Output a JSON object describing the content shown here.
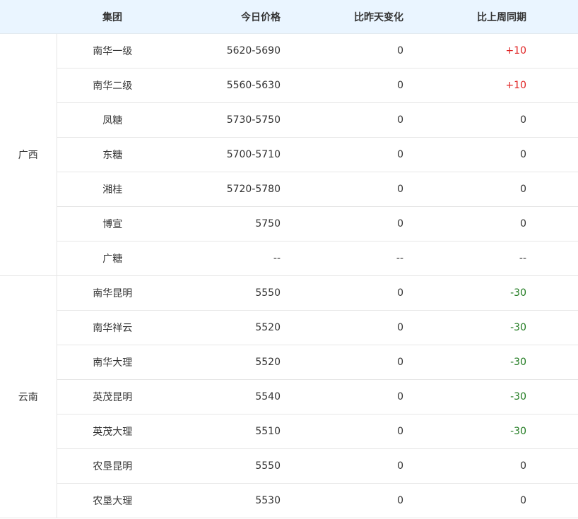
{
  "header": {
    "group": "集团",
    "price": "今日价格",
    "dod": "比昨天变化",
    "wow": "比上周同期"
  },
  "colors": {
    "up": "#e02424",
    "down": "#1f7a1f",
    "header_bg": "#eaf5ff"
  },
  "regions": [
    {
      "name": "广西",
      "rows": [
        {
          "group": "南华一级",
          "price": "5620-5690",
          "dod": "0",
          "wow": "+10",
          "trend": "up"
        },
        {
          "group": "南华二级",
          "price": "5560-5630",
          "dod": "0",
          "wow": "+10",
          "trend": "up"
        },
        {
          "group": "凤糖",
          "price": "5730-5750",
          "dod": "0",
          "wow": "0",
          "trend": "flat"
        },
        {
          "group": "东糖",
          "price": "5700-5710",
          "dod": "0",
          "wow": "0",
          "trend": "flat"
        },
        {
          "group": "湘桂",
          "price": "5720-5780",
          "dod": "0",
          "wow": "0",
          "trend": "flat"
        },
        {
          "group": "博宣",
          "price": "5750",
          "dod": "0",
          "wow": "0",
          "trend": "flat"
        },
        {
          "group": "广糖",
          "price": "--",
          "dod": "--",
          "wow": "--",
          "trend": "flat"
        }
      ]
    },
    {
      "name": "云南",
      "rows": [
        {
          "group": "南华昆明",
          "price": "5550",
          "dod": "0",
          "wow": "-30",
          "trend": "down"
        },
        {
          "group": "南华祥云",
          "price": "5520",
          "dod": "0",
          "wow": "-30",
          "trend": "down"
        },
        {
          "group": "南华大理",
          "price": "5520",
          "dod": "0",
          "wow": "-30",
          "trend": "down"
        },
        {
          "group": "英茂昆明",
          "price": "5540",
          "dod": "0",
          "wow": "-30",
          "trend": "down"
        },
        {
          "group": "英茂大理",
          "price": "5510",
          "dod": "0",
          "wow": "-30",
          "trend": "down"
        },
        {
          "group": "农垦昆明",
          "price": "5550",
          "dod": "0",
          "wow": "0",
          "trend": "flat"
        },
        {
          "group": "农垦大理",
          "price": "5530",
          "dod": "0",
          "wow": "0",
          "trend": "flat"
        }
      ]
    }
  ]
}
